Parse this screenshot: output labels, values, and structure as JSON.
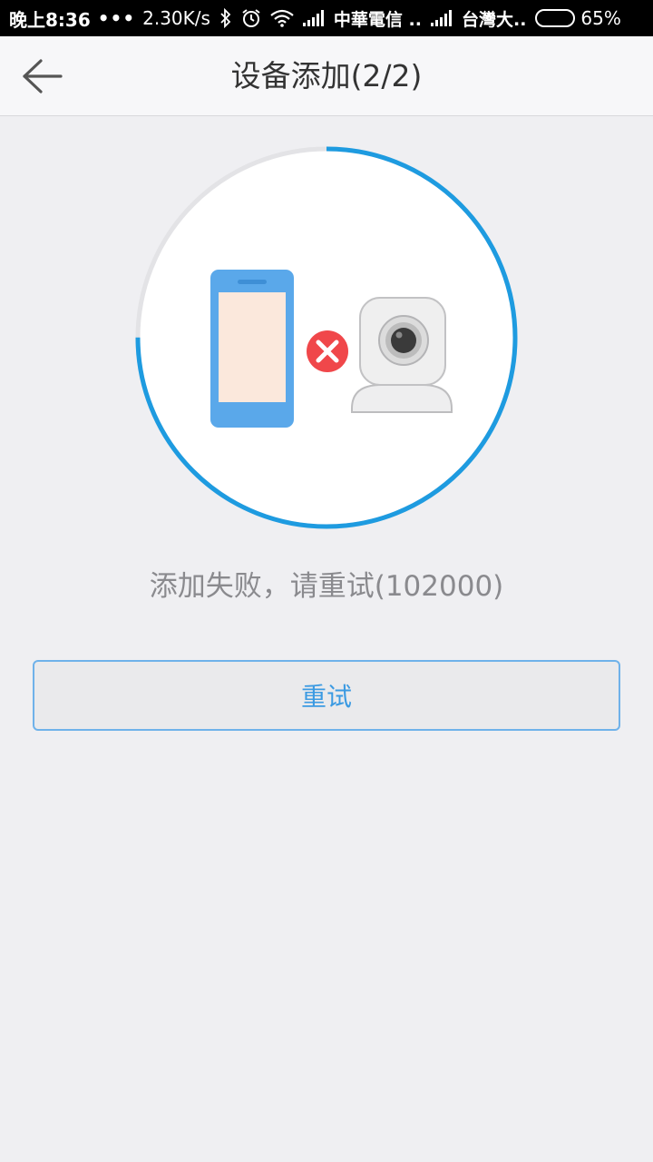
{
  "status_bar": {
    "time": "晚上8:36",
    "dots": "•••",
    "network_speed": "2.30K/s",
    "carrier_1": "中華電信 ..",
    "carrier_2": "台灣大..",
    "battery_percent": "65%",
    "battery_level": 0.65,
    "icons": [
      "bluetooth-icon",
      "alarm-icon",
      "wifi-icon",
      "signal-icon",
      "signal-icon",
      "battery-icon"
    ]
  },
  "header": {
    "title": "设备添加(2/2)",
    "back_icon": "back-arrow-icon"
  },
  "illustration": {
    "progress": 0.75,
    "progress_color": "#1e9be0",
    "track_color": "#e3e3e6",
    "phone_color": "#5aa8ea",
    "phone_screen_color": "#fbe8dc",
    "error_badge_color": "#f0474a",
    "icons": [
      "phone-icon",
      "error-icon",
      "camera-icon"
    ]
  },
  "message": {
    "text": "添加失败，请重试(102000)"
  },
  "retry": {
    "label": "重试"
  }
}
